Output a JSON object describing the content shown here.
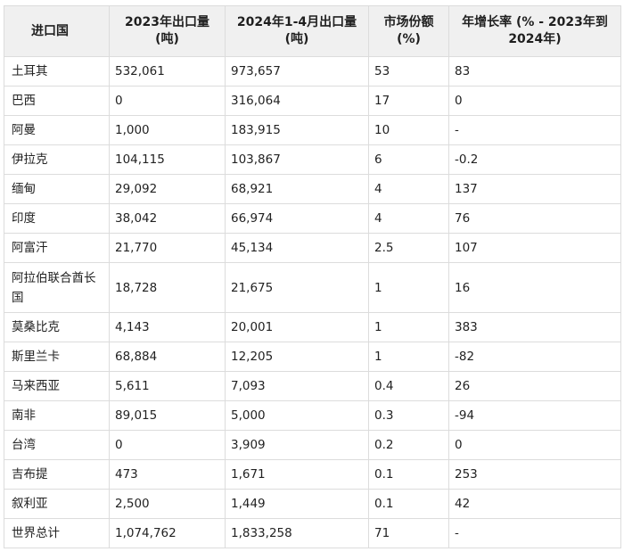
{
  "table": {
    "headers": [
      "进口国",
      "2023年出口量 (吨)",
      "2024年1-4月出口量 (吨)",
      "市场份额 (%)",
      "年增长率 (% - 2023年到 2024年)"
    ],
    "rows": [
      [
        "土耳其",
        "532,061",
        "973,657",
        "53",
        "83"
      ],
      [
        "巴西",
        "0",
        "316,064",
        "17",
        "0"
      ],
      [
        "阿曼",
        "1,000",
        "183,915",
        "10",
        "-"
      ],
      [
        "伊拉克",
        "104,115",
        "103,867",
        "6",
        "-0.2"
      ],
      [
        "缅甸",
        "29,092",
        "68,921",
        "4",
        "137"
      ],
      [
        "印度",
        "38,042",
        "66,974",
        "4",
        "76"
      ],
      [
        "阿富汗",
        "21,770",
        "45,134",
        "2.5",
        "107"
      ],
      [
        "阿拉伯联合酋长国",
        "18,728",
        "21,675",
        "1",
        "16"
      ],
      [
        "莫桑比克",
        "4,143",
        "20,001",
        "1",
        "383"
      ],
      [
        "斯里兰卡",
        "68,884",
        "12,205",
        "1",
        "-82"
      ],
      [
        "马来西亚",
        "5,611",
        "7,093",
        "0.4",
        "26"
      ],
      [
        "南非",
        "89,015",
        "5,000",
        "0.3",
        "-94"
      ],
      [
        "台湾",
        "0",
        "3,909",
        "0.2",
        "0"
      ],
      [
        "吉布提",
        "473",
        "1,671",
        "0.1",
        "253"
      ],
      [
        "叙利亚",
        "2,500",
        "1,449",
        "0.1",
        "42"
      ],
      [
        "世界总计",
        "1,074,762",
        "1,833,258",
        "71",
        "-"
      ]
    ]
  }
}
